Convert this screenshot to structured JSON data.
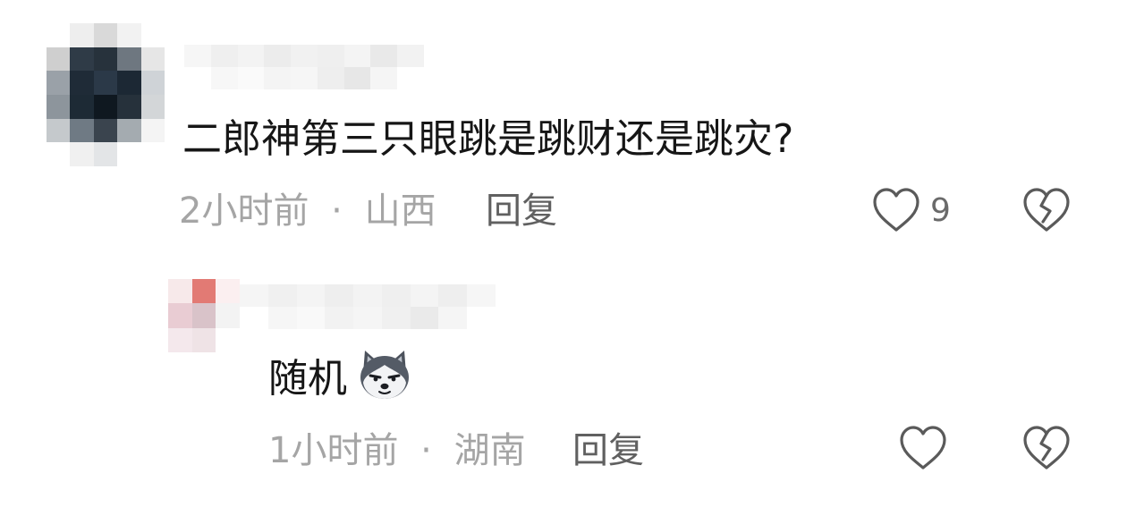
{
  "colors": {
    "text_primary": "#161616",
    "text_meta": "#a5a5a5",
    "reply_link": "#606060",
    "icon_stroke": "#5a5a5a"
  },
  "comments": [
    {
      "id": "comment-main",
      "avatar": "pixelated-avatar",
      "username": "",
      "text": "二郎神第三只眼跳是跳财还是跳灾?",
      "time": "2小时前",
      "separator": "·",
      "location": "山西",
      "reply_label": "回复",
      "like_count": "9",
      "like_icon": "heart-outline-icon",
      "dislike_icon": "broken-heart-icon"
    },
    {
      "id": "comment-reply",
      "avatar": "pixelated-avatar",
      "username": "",
      "text": "随机",
      "emoji": "husky-dog-emoji",
      "time": "1小时前",
      "separator": "·",
      "location": "湖南",
      "reply_label": "回复",
      "like_count": "",
      "like_icon": "heart-outline-icon",
      "dislike_icon": "broken-heart-icon"
    }
  ]
}
